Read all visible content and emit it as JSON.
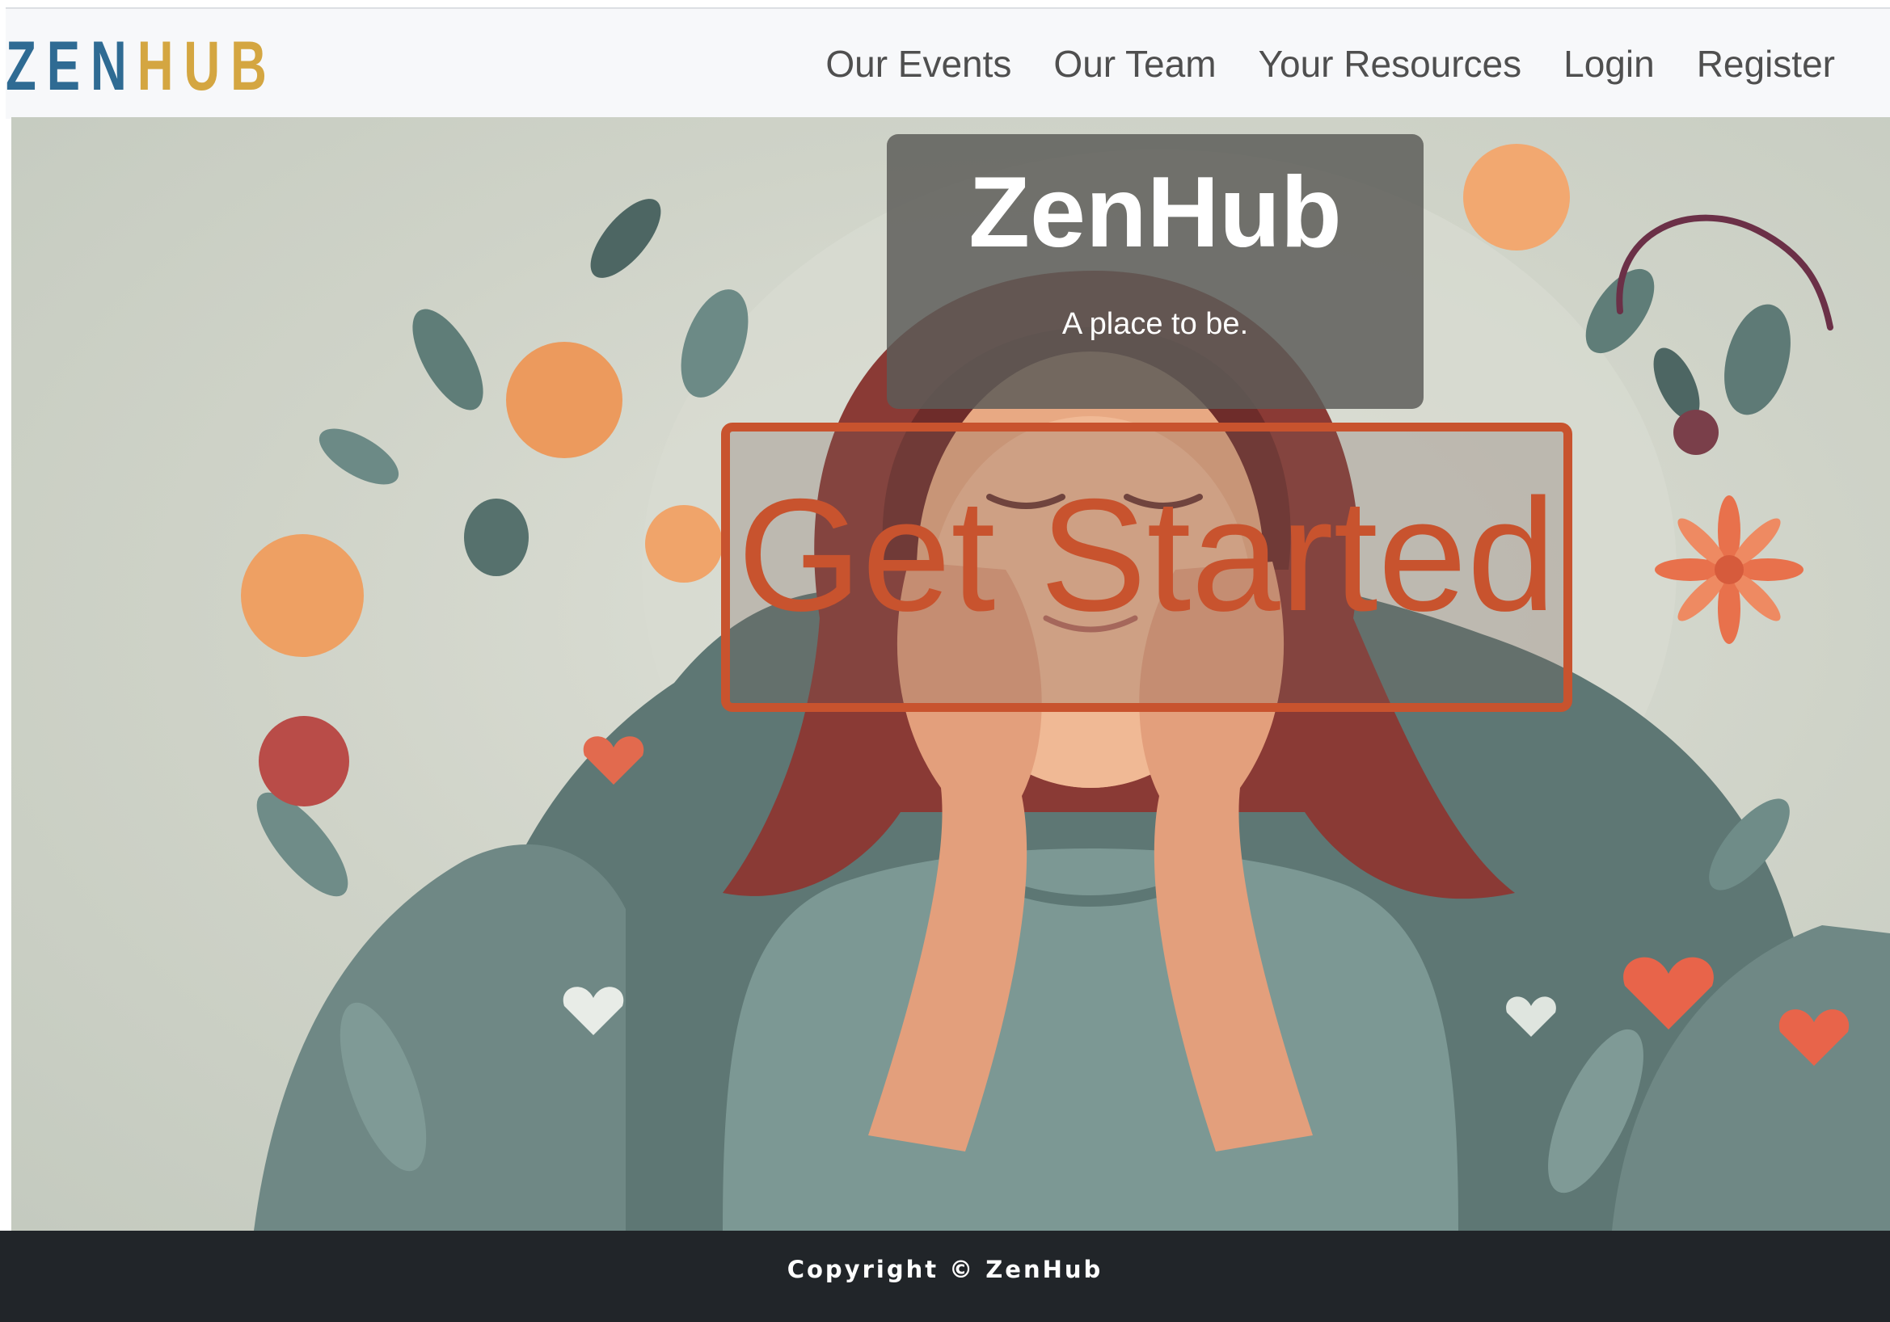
{
  "brand": {
    "part1": "ZEN",
    "part2": "HUB",
    "color1": "#2f6b93",
    "color2": "#d4a641"
  },
  "nav": {
    "links": [
      {
        "label": "Our Events"
      },
      {
        "label": "Our Team"
      },
      {
        "label": "Your Resources"
      },
      {
        "label": "Login"
      },
      {
        "label": "Register"
      }
    ]
  },
  "hero": {
    "title": "ZenHub",
    "subtitle": "A place to be.",
    "cta_label": "Get Started",
    "accent_color": "#c8532e",
    "image_icon": "meditating-woman-illustration"
  },
  "footer": {
    "copyright": "Copyright © ZenHub"
  }
}
